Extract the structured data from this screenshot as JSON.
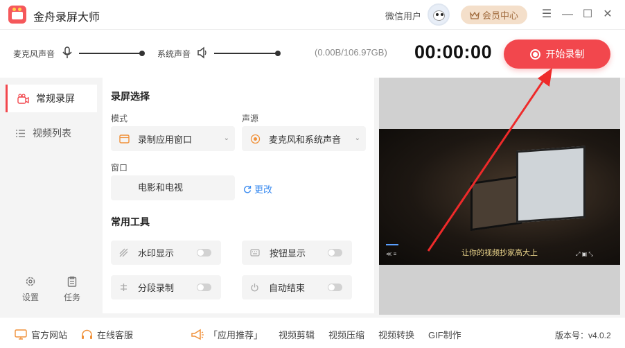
{
  "app": {
    "title": "金舟录屏大师",
    "user_name": "微信用户",
    "vip_label": "会员中心",
    "accent_color": "#f2474d"
  },
  "window_controls": {
    "menu": "☰",
    "minimize": "—",
    "maximize": "☐",
    "close": "✕"
  },
  "toolbar": {
    "mic_label": "麦克风声音",
    "system_label": "系统声音",
    "storage": "(0.00B/106.97GB)",
    "timer": "00:00:00",
    "start_label": "开始录制"
  },
  "sidebar": {
    "items": [
      {
        "label": "常规录屏",
        "active": true,
        "icon": "camera-icon"
      },
      {
        "label": "视频列表",
        "active": false,
        "icon": "list-icon"
      }
    ],
    "settings_label": "设置",
    "tasks_label": "任务"
  },
  "panel": {
    "screen_section_title": "录屏选择",
    "mode_label": "模式",
    "mode_value": "录制应用窗口",
    "audio_label": "声源",
    "audio_value": "麦克风和系统声音",
    "window_label": "窗口",
    "window_value": "电影和电视",
    "change_label": "更改",
    "tools_title": "常用工具",
    "tools": [
      {
        "label": "水印显示",
        "on": false,
        "icon": "watermark-icon"
      },
      {
        "label": "按钮显示",
        "on": false,
        "icon": "keyboard-icon"
      },
      {
        "label": "分段录制",
        "on": false,
        "icon": "segment-icon"
      },
      {
        "label": "自动结束",
        "on": false,
        "icon": "power-icon"
      }
    ]
  },
  "preview": {
    "subtitle": "让你的视频抄家高大上"
  },
  "footer": {
    "website": "官方网站",
    "support": "在线客服",
    "recommend": "「应用推荐」",
    "links": [
      "视频剪辑",
      "视频压缩",
      "视频转换",
      "GIF制作"
    ],
    "version": "版本号：v4.0.2"
  }
}
